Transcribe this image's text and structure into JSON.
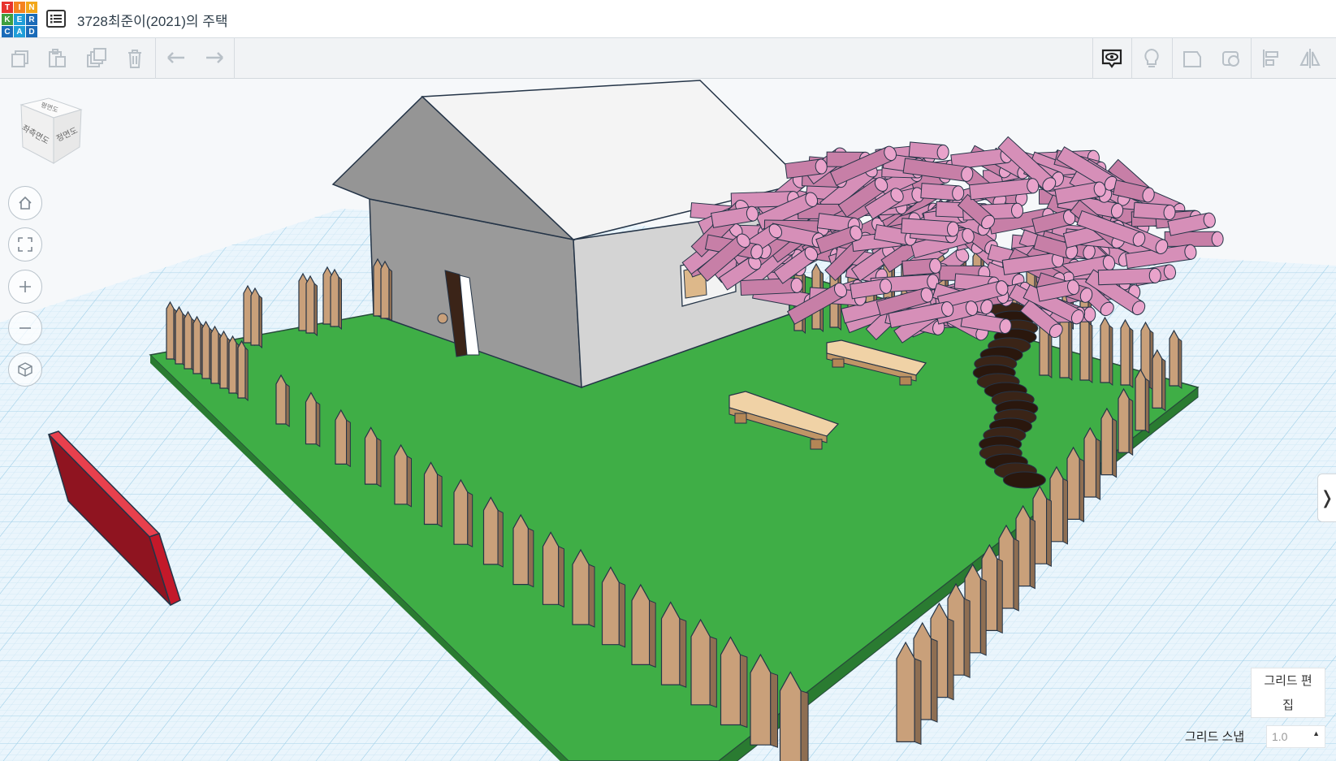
{
  "app": {
    "logo_letters": [
      "T",
      "I",
      "N",
      "K",
      "E",
      "R",
      "C",
      "A",
      "D"
    ],
    "logo_colors": [
      "#e7332e",
      "#f58220",
      "#f2a71b",
      "#3f9f3f",
      "#1f9ed8",
      "#1a6bb8",
      "#1a6bb8",
      "#1f9ed8",
      "#1a6bb8"
    ],
    "title": "3728최준이(2021)의 주택"
  },
  "toolbar": {
    "left_icons": [
      "copy-icon",
      "paste-icon",
      "duplicate-icon",
      "delete-icon",
      "undo-icon",
      "redo-icon"
    ],
    "right_icons": [
      "show-all-icon",
      "notes-light-icon",
      "workplane-icon",
      "ruler-icon",
      "align-icon",
      "mirror-icon"
    ]
  },
  "viewcube": {
    "face_front": "정면도",
    "face_left": "좌측면도",
    "face_top": "평면도"
  },
  "view_controls": [
    "home-view-icon",
    "fit-all-icon",
    "zoom-in-icon",
    "zoom-out-icon",
    "orthographic-icon"
  ],
  "colors": {
    "lawn": "#3fae46",
    "fence": "#c9a07a",
    "house_wall": "#cfcfcf",
    "roof": "#f4f4f4",
    "blossom": "#e9a3cb",
    "trunk": "#3a2417",
    "bench": "#ddb88a",
    "red_panel": "#c3192a"
  },
  "grid_panel": {
    "edit_label_line1": "그리드 편",
    "edit_label_line2": "집",
    "snap_label": "그리드 스냅",
    "snap_value": "1.0"
  }
}
